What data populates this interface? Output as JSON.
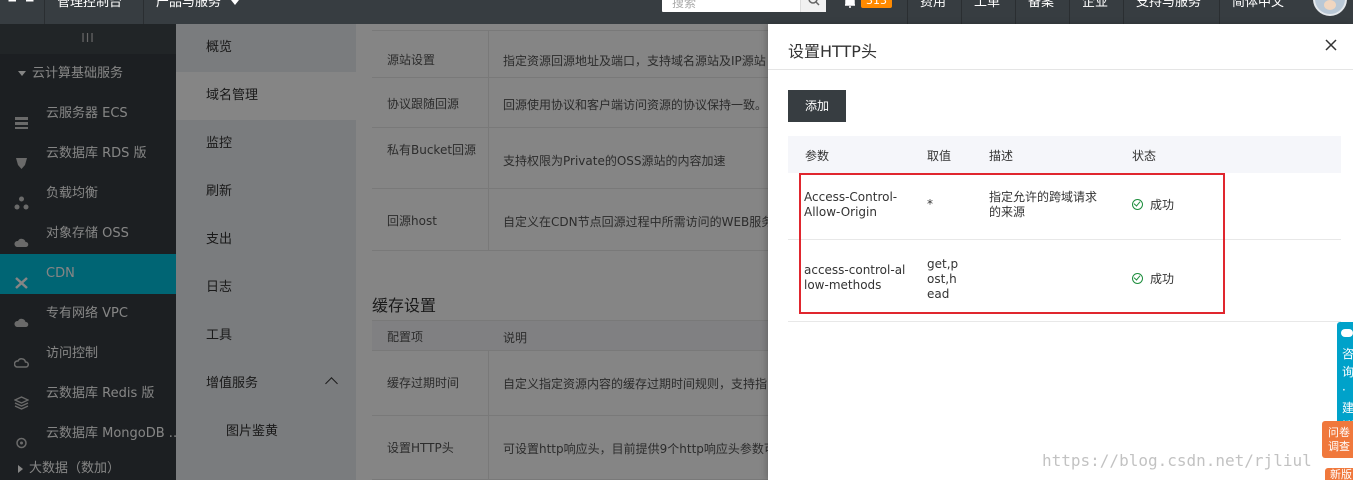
{
  "topbar": {
    "console_label": "管理控制台",
    "products_label": "产品与服务",
    "search_placeholder": "搜索",
    "notification_count": "313",
    "nav": [
      "费用",
      "工单",
      "备案",
      "企业",
      "支持与服务",
      "简体中文"
    ]
  },
  "sidebar": {
    "collapse_label": "III",
    "group_label": "云计算基础服务",
    "items": [
      {
        "label": "云服务器 ECS",
        "icon": "server-icon"
      },
      {
        "label": "云数据库 RDS 版",
        "icon": "database-icon"
      },
      {
        "label": "负载均衡",
        "icon": "load-balancer-icon"
      },
      {
        "label": "对象存储 OSS",
        "icon": "cloud-storage-icon"
      },
      {
        "label": "CDN",
        "icon": "cdn-icon"
      },
      {
        "label": "专有网络 VPC",
        "icon": "vpc-cloud-icon"
      },
      {
        "label": "访问控制",
        "icon": "access-control-icon"
      },
      {
        "label": "云数据库 Redis 版",
        "icon": "redis-icon"
      },
      {
        "label": "云数据库 MongoDB ...",
        "icon": "mongodb-icon"
      }
    ],
    "bottom_group_label": "大数据（数加）",
    "active_color": "#00c1de"
  },
  "subnav": {
    "items": [
      "概览",
      "域名管理",
      "监控",
      "刷新",
      "支出",
      "日志",
      "工具",
      "增值服务"
    ],
    "sub_item": "图片鉴黄"
  },
  "main": {
    "rows": [
      {
        "key": "源站设置",
        "desc": "指定资源回源地址及端口，支持域名源站及IP源站"
      },
      {
        "key": "协议跟随回源",
        "desc": "回源使用协议和客户端访问资源的协议保持一致。"
      },
      {
        "key": "私有Bucket回源",
        "desc": "支持权限为Private的OSS源站的内容加速"
      },
      {
        "key": "回源host",
        "desc": "自定义在CDN节点回源过程中所需访问的WEB服务"
      }
    ],
    "cache_title": "缓存设置",
    "cache_header": {
      "key": "配置项",
      "desc": "说明"
    },
    "cache_rows": [
      {
        "key": "缓存过期时间",
        "desc": "自定义指定资源内容的缓存过期时间规则，支持指"
      },
      {
        "key": "设置HTTP头",
        "desc": "可设置http响应头，目前提供9个http响应头参数可"
      }
    ]
  },
  "drawer": {
    "title": "设置HTTP头",
    "add_label": "添加",
    "columns": [
      "参数",
      "取值",
      "描述",
      "状态"
    ],
    "rows": [
      {
        "param_lines": [
          "Access-Control-",
          "Allow-Origin"
        ],
        "value_lines": [
          "*"
        ],
        "desc_lines": [
          "指定允许的跨域请求",
          "的来源"
        ],
        "status": "成功"
      },
      {
        "param_lines": [
          "access-control-al",
          "low-methods"
        ],
        "value_lines": [
          "get,p",
          "ost,h",
          "ead"
        ],
        "desc_lines": [],
        "status": "成功"
      }
    ],
    "highlight_color": "#e0262e",
    "status_color": "#1e8e3e"
  },
  "floats": {
    "consult_text": [
      "咨",
      "询",
      "·",
      "建",
      "议"
    ],
    "survey_text": [
      "问卷",
      "调查"
    ],
    "new_text": "新版"
  },
  "watermark": "https://blog.csdn.net/rjliul"
}
